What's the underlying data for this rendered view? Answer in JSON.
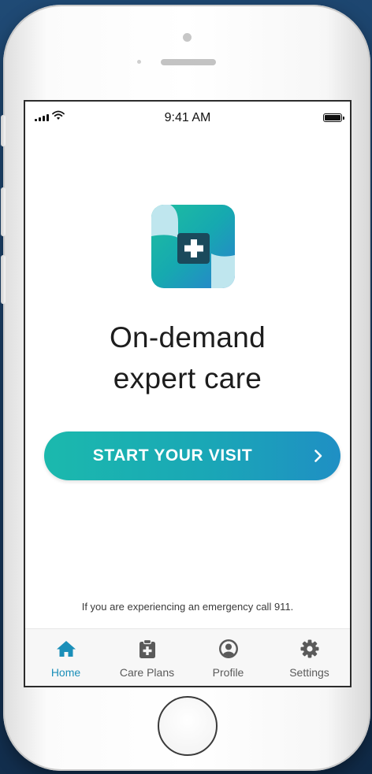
{
  "status_bar": {
    "time": "9:41 AM",
    "signal_icon": "cellular-signal-icon",
    "wifi_icon": "wifi-icon",
    "battery_icon": "battery-icon"
  },
  "app": {
    "logo_icon": "medical-plus-logo-icon",
    "headline_line1": "On-demand",
    "headline_line2": "expert care",
    "cta": {
      "label": "START YOUR VISIT",
      "icon": "chevron-right-icon"
    },
    "emergency_notice": "If you are experiencing an emergency call 911."
  },
  "tabs": [
    {
      "label": "Home",
      "icon": "home-icon",
      "active": true
    },
    {
      "label": "Care Plans",
      "icon": "clipboard-plus-icon",
      "active": false
    },
    {
      "label": "Profile",
      "icon": "user-circle-icon",
      "active": false
    },
    {
      "label": "Settings",
      "icon": "gear-icon",
      "active": false
    }
  ],
  "colors": {
    "background": "#17385d",
    "accent_teal": "#1bb9ad",
    "accent_blue": "#1f8fc4",
    "active_tab": "#1b8fb9",
    "inactive_tab": "#5a5a5a",
    "text_primary": "#1d1d1d"
  }
}
